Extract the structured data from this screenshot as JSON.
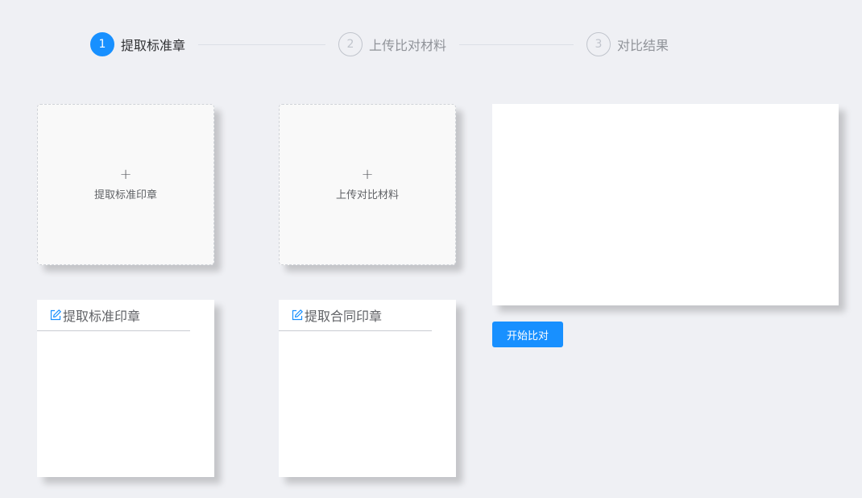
{
  "steps": [
    {
      "number": "1",
      "title": "提取标准章",
      "state": "active"
    },
    {
      "number": "2",
      "title": "上传比对材料",
      "state": "inactive"
    },
    {
      "number": "3",
      "title": "对比结果",
      "state": "inactive"
    }
  ],
  "upload_standard": {
    "icon": "+",
    "label": "提取标准印章"
  },
  "upload_compare": {
    "icon": "+",
    "label": "上传对比材料"
  },
  "panel_standard": {
    "title": "提取标准印章"
  },
  "panel_contract": {
    "title": "提取合同印章"
  },
  "compare": {
    "button_label": "开始比对"
  },
  "colors": {
    "primary": "#1890ff",
    "background": "#eff0f4",
    "inactive_step": "#c0c4cc"
  }
}
